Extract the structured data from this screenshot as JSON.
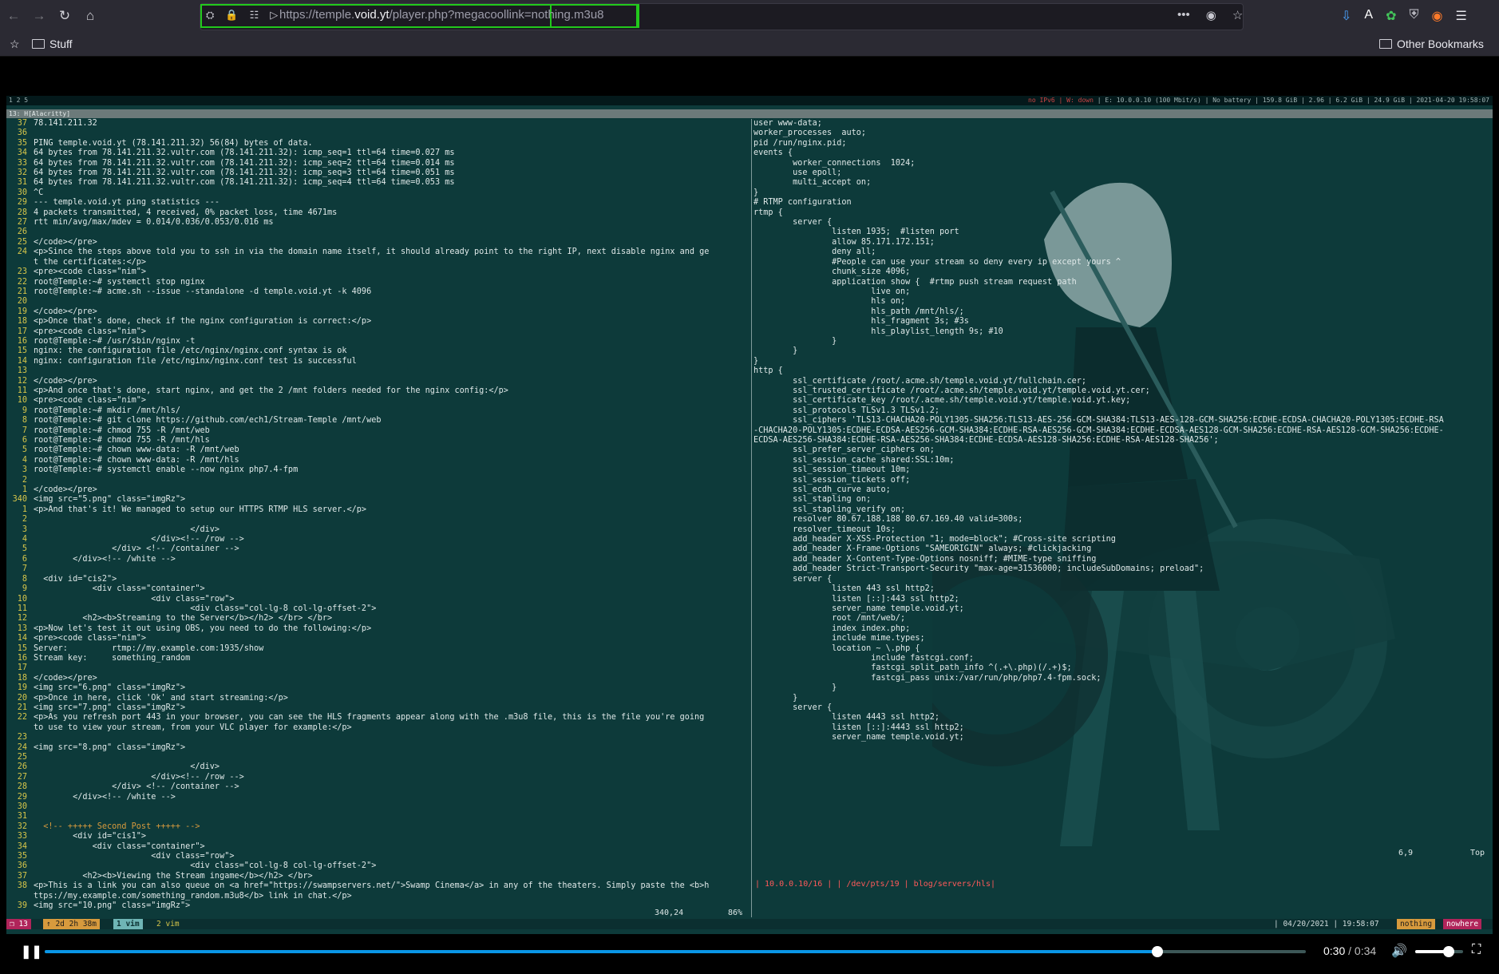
{
  "browser": {
    "url_prefix": "https://temple.",
    "url_domain": "void.yt",
    "url_path": "/player.php?megacoollink=",
    "url_param": "nothing.m3u8",
    "more_label": "•••",
    "bookmarks": {
      "folder": "Stuff",
      "other": "Other Bookmarks"
    }
  },
  "i3": {
    "workspaces": "1 2 5",
    "status_warn": "no IPv6 | W: down ",
    "status_text": "| E: 10.0.0.10 (100 Mbit/s) | No battery | 159.8 GiB | 2.96 | 6.2 GiB | 24.9 GiB | 2021-04-20 19:58:07",
    "window_title": "13: H[Alacritty]"
  },
  "editor_left": {
    "lines": [
      {
        "n": "37",
        "t": "78.141.211.32"
      },
      {
        "n": "36",
        "t": ""
      },
      {
        "n": "35",
        "t": "PING temple.void.yt (78.141.211.32) 56(84) bytes of data."
      },
      {
        "n": "34",
        "t": "64 bytes from 78.141.211.32.vultr.com (78.141.211.32): icmp_seq=1 ttl=64 time=0.027 ms"
      },
      {
        "n": "33",
        "t": "64 bytes from 78.141.211.32.vultr.com (78.141.211.32): icmp_seq=2 ttl=64 time=0.014 ms"
      },
      {
        "n": "32",
        "t": "64 bytes from 78.141.211.32.vultr.com (78.141.211.32): icmp_seq=3 ttl=64 time=0.051 ms"
      },
      {
        "n": "31",
        "t": "64 bytes from 78.141.211.32.vultr.com (78.141.211.32): icmp_seq=4 ttl=64 time=0.053 ms"
      },
      {
        "n": "30",
        "t": "^C"
      },
      {
        "n": "29",
        "t": "--- temple.void.yt ping statistics ---"
      },
      {
        "n": "28",
        "t": "4 packets transmitted, 4 received, 0% packet loss, time 4671ms"
      },
      {
        "n": "27",
        "t": "rtt min/avg/max/mdev = 0.014/0.036/0.053/0.016 ms"
      },
      {
        "n": "26",
        "t": ""
      },
      {
        "n": "25",
        "t": "</code></pre>"
      },
      {
        "n": "24",
        "t": "<p>Since the steps above told you to ssh in via the domain name itself, it should already point to the right IP, next disable nginx and ge"
      },
      {
        "n": "",
        "t": "t the certificates:</p>"
      },
      {
        "n": "23",
        "t": "<pre><code class=\"nim\">"
      },
      {
        "n": "22",
        "t": "root@Temple:~# systemctl stop nginx"
      },
      {
        "n": "21",
        "t": "root@Temple:~# acme.sh --issue --standalone -d temple.void.yt -k 4096"
      },
      {
        "n": "20",
        "t": ""
      },
      {
        "n": "19",
        "t": "</code></pre>"
      },
      {
        "n": "18",
        "t": "<p>Once that's done, check if the nginx configuration is correct:</p>"
      },
      {
        "n": "17",
        "t": "<pre><code class=\"nim\">"
      },
      {
        "n": "16",
        "t": "root@Temple:~# /usr/sbin/nginx -t"
      },
      {
        "n": "15",
        "t": "nginx: the configuration file /etc/nginx/nginx.conf syntax is ok"
      },
      {
        "n": "14",
        "t": "nginx: configuration file /etc/nginx/nginx.conf test is successful"
      },
      {
        "n": "13",
        "t": ""
      },
      {
        "n": "12",
        "t": "</code></pre>"
      },
      {
        "n": "11",
        "t": "<p>And once that's done, start nginx, and get the 2 /mnt folders needed for the nginx config:</p>"
      },
      {
        "n": "10",
        "t": "<pre><code class=\"nim\">"
      },
      {
        "n": "9",
        "t": "root@Temple:~# mkdir /mnt/hls/"
      },
      {
        "n": "8",
        "t": "root@Temple:~# git clone https://github.com/ech1/Stream-Temple /mnt/web"
      },
      {
        "n": "7",
        "t": "root@Temple:~# chmod 755 -R /mnt/web"
      },
      {
        "n": "6",
        "t": "root@Temple:~# chmod 755 -R /mnt/hls"
      },
      {
        "n": "5",
        "t": "root@Temple:~# chown www-data: -R /mnt/web"
      },
      {
        "n": "4",
        "t": "root@Temple:~# chown www-data: -R /mnt/hls"
      },
      {
        "n": "3",
        "t": "root@Temple:~# systemctl enable --now nginx php7.4-fpm"
      },
      {
        "n": "2",
        "t": ""
      },
      {
        "n": "1",
        "t": "</code></pre>"
      },
      {
        "n": "340",
        "t": "<img src=\"5.png\" class=\"imgRz\">"
      },
      {
        "n": "1",
        "t": "<p>And that's it! We managed to setup our HTTPS RTMP HLS server.</p>"
      },
      {
        "n": "2",
        "t": ""
      },
      {
        "n": "3",
        "t": "                                </div>"
      },
      {
        "n": "4",
        "t": "                        </div><!-- /row -->"
      },
      {
        "n": "5",
        "t": "                </div> <!-- /container -->"
      },
      {
        "n": "6",
        "t": "        </div><!-- /white -->"
      },
      {
        "n": "7",
        "t": ""
      },
      {
        "n": "8",
        "t": "  <div id=\"cis2\">"
      },
      {
        "n": "9",
        "t": "            <div class=\"container\">"
      },
      {
        "n": "10",
        "t": "                        <div class=\"row\">"
      },
      {
        "n": "11",
        "t": "                                <div class=\"col-lg-8 col-lg-offset-2\">"
      },
      {
        "n": "12",
        "t": "          <h2><b>Streaming to the Server</b></h2> </br> </br>"
      },
      {
        "n": "13",
        "t": "<p>Now let's test it out using OBS, you need to do the following:</p>"
      },
      {
        "n": "14",
        "t": "<pre><code class=\"nim\">"
      },
      {
        "n": "15",
        "t": "Server:         rtmp://my.example.com:1935/show"
      },
      {
        "n": "16",
        "t": "Stream key:     something_random"
      },
      {
        "n": "17",
        "t": ""
      },
      {
        "n": "18",
        "t": "</code></pre>"
      },
      {
        "n": "19",
        "t": "<img src=\"6.png\" class=\"imgRz\">"
      },
      {
        "n": "20",
        "t": "<p>Once in here, click 'Ok' and start streaming:</p>"
      },
      {
        "n": "21",
        "t": "<img src=\"7.png\" class=\"imgRz\">"
      },
      {
        "n": "22",
        "t": "<p>As you refresh port 443 in your browser, you can see the HLS fragments appear along with the .m3u8 file, this is the file you're going"
      },
      {
        "n": "",
        "t": "to use to view your stream, from your VLC player for example:</p>"
      },
      {
        "n": "23",
        "t": ""
      },
      {
        "n": "24",
        "t": "<img src=\"8.png\" class=\"imgRz\">"
      },
      {
        "n": "25",
        "t": ""
      },
      {
        "n": "26",
        "t": "                                </div>"
      },
      {
        "n": "27",
        "t": "                        </div><!-- /row -->"
      },
      {
        "n": "28",
        "t": "                </div> <!-- /container -->"
      },
      {
        "n": "29",
        "t": "        </div><!-- /white -->"
      },
      {
        "n": "30",
        "t": ""
      },
      {
        "n": "31",
        "t": ""
      },
      {
        "n": "32",
        "t": "  <!-- +++++ Second Post +++++ -->"
      },
      {
        "n": "33",
        "t": "        <div id=\"cis1\">"
      },
      {
        "n": "34",
        "t": "            <div class=\"container\">"
      },
      {
        "n": "35",
        "t": "                        <div class=\"row\">"
      },
      {
        "n": "36",
        "t": "                                <div class=\"col-lg-8 col-lg-offset-2\">"
      },
      {
        "n": "37",
        "t": "          <h2><b>Viewing the Stream ingame</b></h2> </br>"
      },
      {
        "n": "38",
        "t": "<p>This is a link you can also queue on <a href=\"https://swampservers.net/\">Swamp Cinema</a> in any of the theaters. Simply paste the <b>h"
      },
      {
        "n": "",
        "t": "ttps://my.example.com/something_random.m3u8</b> link in chat.</p>"
      },
      {
        "n": "39",
        "t": "<img src=\"10.png\" class=\"imgRz\">"
      }
    ],
    "cursor_pos": "340,24",
    "percent": "86%"
  },
  "editor_right": {
    "lines": [
      "user www-data;",
      "worker_processes  auto;",
      "pid /run/nginx.pid;",
      "",
      "events {",
      "        worker_connections  1024;",
      "        use epoll;",
      "        multi_accept on;",
      "}",
      "",
      "# RTMP configuration",
      "rtmp {",
      "        server {",
      "                listen 1935;  #listen port",
      "                allow 85.171.172.151;",
      "                deny all;",
      "                #People can use your stream so deny every ip except yours ^",
      "",
      "                chunk_size 4096;",
      "                application show {  #rtmp push stream request path",
      "                        live on;",
      "                        hls on;",
      "                        hls_path /mnt/hls/;",
      "                        hls_fragment 3s; #3s",
      "                        hls_playlist_length 9s; #10",
      "                }",
      "        }",
      "}",
      "",
      "",
      "http {",
      "        ssl_certificate /root/.acme.sh/temple.void.yt/fullchain.cer;",
      "        ssl_trusted_certificate /root/.acme.sh/temple.void.yt/temple.void.yt.cer;",
      "        ssl_certificate_key /root/.acme.sh/temple.void.yt/temple.void.yt.key;",
      "",
      "        ssl_protocols TLSv1.3 TLSv1.2;",
      "        ssl_ciphers 'TLS13-CHACHA20-POLY1305-SHA256:TLS13-AES-256-GCM-SHA384:TLS13-AES-128-GCM-SHA256:ECDHE-ECDSA-CHACHA20-POLY1305:ECDHE-RSA",
      "-CHACHA20-POLY1305:ECDHE-ECDSA-AES256-GCM-SHA384:ECDHE-RSA-AES256-GCM-SHA384:ECDHE-ECDSA-AES128-GCM-SHA256:ECDHE-RSA-AES128-GCM-SHA256:ECDHE-",
      "ECDSA-AES256-SHA384:ECDHE-RSA-AES256-SHA384:ECDHE-ECDSA-AES128-SHA256:ECDHE-RSA-AES128-SHA256';",
      "        ssl_prefer_server_ciphers on;",
      "        ssl_session_cache shared:SSL:10m;",
      "        ssl_session_timeout 10m;",
      "        ssl_session_tickets off;",
      "        ssl_ecdh_curve auto;",
      "        ssl_stapling on;",
      "        ssl_stapling_verify on;",
      "        resolver 80.67.188.188 80.67.169.40 valid=300s;",
      "        resolver_timeout 10s;",
      "",
      "        add_header X-XSS-Protection \"1; mode=block\"; #Cross-site scripting",
      "        add_header X-Frame-Options \"SAMEORIGIN\" always; #clickjacking",
      "        add_header X-Content-Type-Options nosniff; #MIME-type sniffing",
      "        add_header Strict-Transport-Security \"max-age=31536000; includeSubDomains; preload\";",
      "",
      "",
      "        server {",
      "                listen 443 ssl http2;",
      "                listen [::]:443 ssl http2;",
      "                server_name temple.void.yt;",
      "                root /mnt/web/;",
      "                index index.php;",
      "                include mime.types;",
      "                location ~ \\.php {",
      "                        include fastcgi.conf;",
      "                        fastcgi_split_path_info ^(.+\\.php)(/.+)$;",
      "                        fastcgi_pass unix:/var/run/php/php7.4-fpm.sock;",
      "                }",
      "",
      "        }",
      "",
      "        server {",
      "                listen 4443 ssl http2;",
      "                listen [::]:4443 ssl http2;",
      "                server_name temple.void.yt;"
    ],
    "cursor_pos": "6,9",
    "position": "Top",
    "statusline": "| 10.0.0.10/16 | | /dev/pts/19 | blog/servers/hls|"
  },
  "tmux": {
    "session": "❒ 13",
    "uptime": "↑ 2d 2h 38m",
    "win1": "1 vim",
    "win2": "2 vim",
    "datetime": "| 04/20/2021 | 19:58:07",
    "user": "nothing",
    "host": "nowhere"
  },
  "player": {
    "current": "0:30",
    "sep": " / ",
    "duration": "0:34",
    "progress": 0.8824,
    "volume": 0.7,
    "accent": "#0a96e6"
  }
}
